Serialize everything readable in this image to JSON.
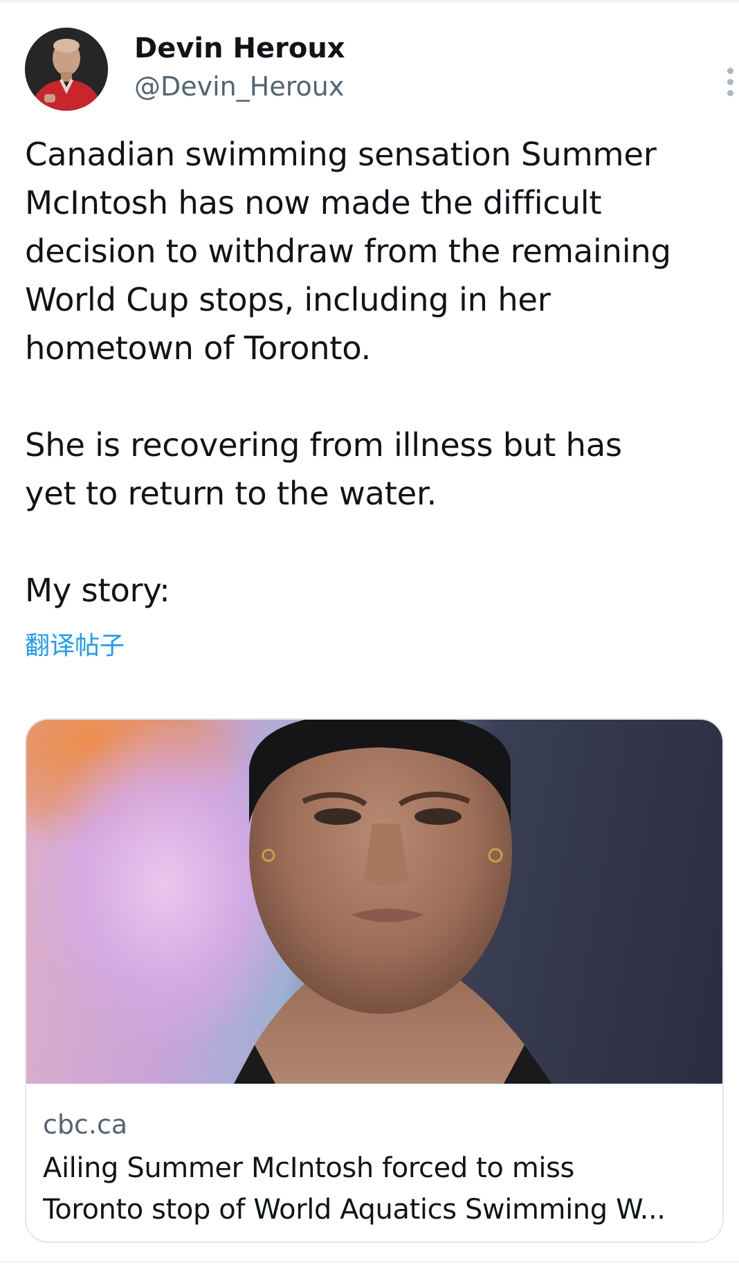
{
  "author": {
    "name": "Devin Heroux",
    "handle": "@Devin_Heroux",
    "avatar_icon": "profile-photo"
  },
  "tweet": {
    "paragraphs": [
      "Canadian swimming sensation Summer\nMcIntosh has now made the difficult\ndecision to withdraw from the remaining\nWorld Cup stops, including in her\nhometown of Toronto.",
      "She is recovering from illness but has\nyet to return to the water.",
      "My story:"
    ],
    "translate_label": "翻译帖子"
  },
  "card": {
    "domain": "cbc.ca",
    "title_line_1": "Ailing Summer McIntosh forced to miss",
    "title_line_2": "Toronto stop of World Aquatics Swimming W..."
  },
  "icons": {
    "more": "more-vertical-icon"
  },
  "colors": {
    "text": "#0f1419",
    "secondary": "#536471",
    "link": "#1d9bf0",
    "border": "#e3e8ec"
  }
}
